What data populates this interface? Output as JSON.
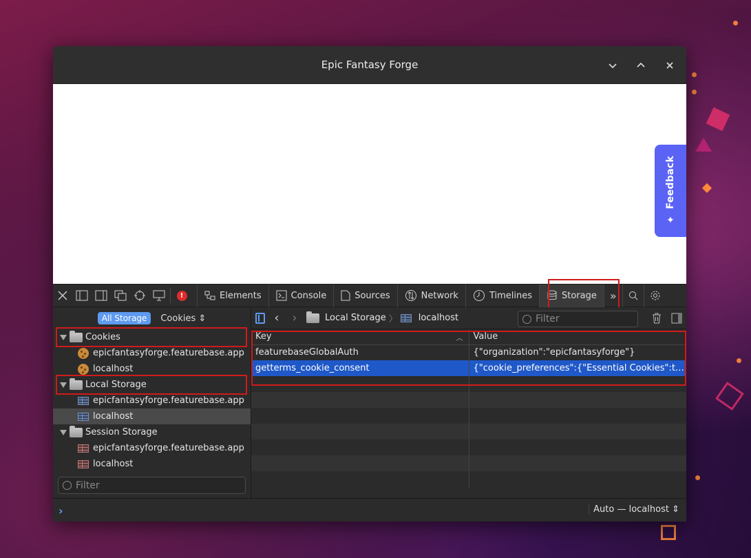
{
  "window": {
    "title": "Epic Fantasy Forge"
  },
  "webview": {
    "feedback_label": "Feedback"
  },
  "toolbar": {
    "error_count": "!",
    "tabs": [
      {
        "label": "Elements",
        "icon": "elements-icon"
      },
      {
        "label": "Console",
        "icon": "console-icon"
      },
      {
        "label": "Sources",
        "icon": "sources-icon"
      },
      {
        "label": "Network",
        "icon": "network-icon"
      },
      {
        "label": "Timelines",
        "icon": "timelines-icon"
      },
      {
        "label": "Storage",
        "icon": "storage-icon",
        "active": true
      }
    ]
  },
  "sidebar": {
    "segments": {
      "all_storage": "All Storage",
      "type_select": "Cookies"
    },
    "groups": [
      {
        "label": "Cookies",
        "items": [
          "epicfantasyforge.featurebase.app",
          "localhost"
        ]
      },
      {
        "label": "Local Storage",
        "items": [
          "epicfantasyforge.featurebase.app",
          "localhost"
        ],
        "selected_item": "localhost"
      },
      {
        "label": "Session Storage",
        "items": [
          "epicfantasyforge.featurebase.app",
          "localhost"
        ]
      }
    ],
    "filter_placeholder": "Filter"
  },
  "content": {
    "breadcrumb": {
      "parent": "Local Storage",
      "current": "localhost"
    },
    "filter_placeholder": "Filter",
    "columns": {
      "key": "Key",
      "value": "Value"
    },
    "rows": [
      {
        "key": "featurebaseGlobalAuth",
        "value": "{\"organization\":\"epicfantasyforge\"}"
      },
      {
        "key": "getterms_cookie_consent",
        "value": "{\"cookie_preferences\":{\"Essential Cookies\":true,\"Fu…",
        "selected": true
      }
    ]
  },
  "console": {
    "prompt": "›",
    "context": "Auto — localhost"
  },
  "colors": {
    "accent": "#5e9bf0",
    "selection": "#1f58c8",
    "highlight_box": "#d11a1a",
    "feedback": "#5b63f5"
  }
}
